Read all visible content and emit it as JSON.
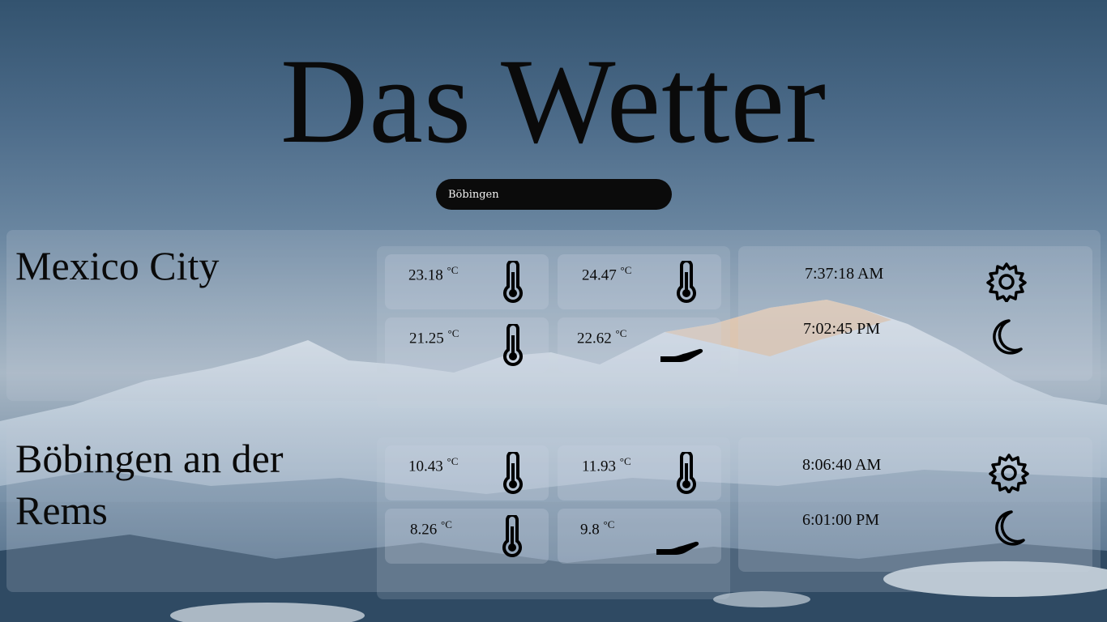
{
  "app": {
    "title": "Das Wetter"
  },
  "search": {
    "value": "Böbingen"
  },
  "cities": [
    {
      "name": "Mexico City",
      "temperatures": [
        {
          "value": "23.18",
          "unit": "°C",
          "icon": "thermometer-icon"
        },
        {
          "value": "24.47",
          "unit": "°C",
          "icon": "thermometer-icon"
        },
        {
          "value": "21.25",
          "unit": "°C",
          "icon": "thermometer-icon"
        },
        {
          "value": "22.62",
          "unit": "°C",
          "icon": "hand-icon"
        }
      ],
      "sunrise": "7:37:18 AM",
      "sunset": "7:02:45 PM"
    },
    {
      "name": "Böbingen an der Rems",
      "temperatures": [
        {
          "value": "10.43",
          "unit": "°C",
          "icon": "thermometer-icon"
        },
        {
          "value": "11.93",
          "unit": "°C",
          "icon": "thermometer-icon"
        },
        {
          "value": "8.26",
          "unit": "°C",
          "icon": "thermometer-icon"
        },
        {
          "value": "9.8",
          "unit": "°C",
          "icon": "hand-icon"
        }
      ],
      "sunrise": "8:06:40 AM",
      "sunset": "6:01:00 PM"
    }
  ],
  "icons": {
    "sunrise": "sun-gear-icon",
    "sunset": "moon-icon"
  }
}
